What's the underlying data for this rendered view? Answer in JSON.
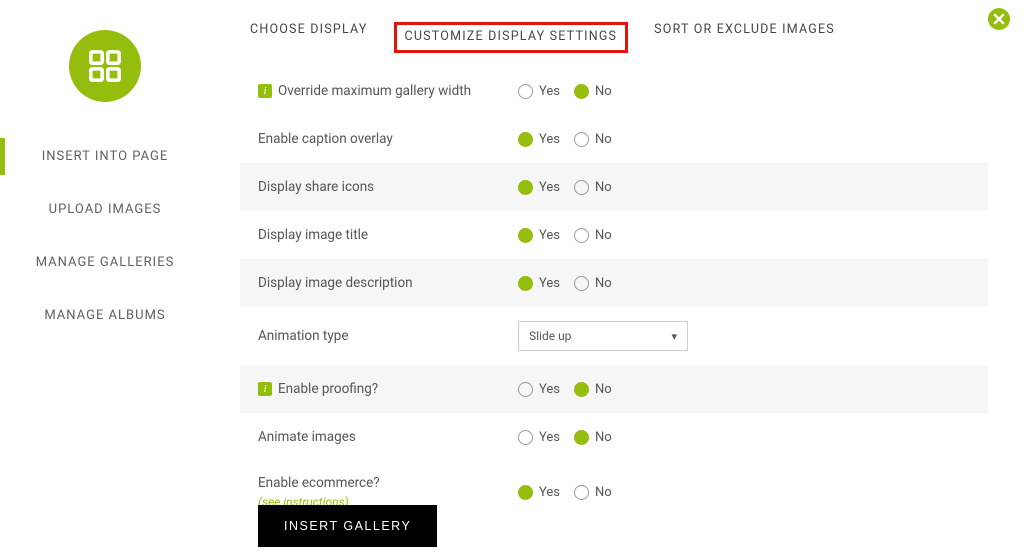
{
  "close_label": "close",
  "sidebar": {
    "items": [
      {
        "label": "INSERT INTO PAGE",
        "active": true
      },
      {
        "label": "UPLOAD IMAGES",
        "active": false
      },
      {
        "label": "MANAGE GALLERIES",
        "active": false
      },
      {
        "label": "MANAGE ALBUMS",
        "active": false
      }
    ]
  },
  "tabs": [
    {
      "label": "CHOOSE DISPLAY",
      "active": false,
      "highlighted": false
    },
    {
      "label": "CUSTOMIZE DISPLAY SETTINGS",
      "active": true,
      "highlighted": true
    },
    {
      "label": "SORT OR EXCLUDE IMAGES",
      "active": false,
      "highlighted": false
    }
  ],
  "yes_label": "Yes",
  "no_label": "No",
  "settings": [
    {
      "label": "Override maximum gallery width",
      "info": true,
      "value": "No",
      "type": "radio",
      "alt": false
    },
    {
      "label": "Enable caption overlay",
      "info": false,
      "value": "Yes",
      "type": "radio",
      "alt": false
    },
    {
      "label": "Display share icons",
      "info": false,
      "value": "Yes",
      "type": "radio",
      "alt": true
    },
    {
      "label": "Display image title",
      "info": false,
      "value": "Yes",
      "type": "radio",
      "alt": false
    },
    {
      "label": "Display image description",
      "info": false,
      "value": "Yes",
      "type": "radio",
      "alt": true
    },
    {
      "label": "Animation type",
      "info": false,
      "value": "Slide up",
      "type": "select",
      "alt": false
    },
    {
      "label": "Enable proofing?",
      "info": true,
      "value": "No",
      "type": "radio",
      "alt": true
    },
    {
      "label": "Animate images",
      "info": false,
      "value": "No",
      "type": "radio",
      "alt": false
    },
    {
      "label": "Enable ecommerce?",
      "info": false,
      "value": "Yes",
      "type": "radio",
      "alt": false,
      "link_text": "(see instructions)"
    }
  ],
  "insert_button_label": "INSERT GALLERY"
}
